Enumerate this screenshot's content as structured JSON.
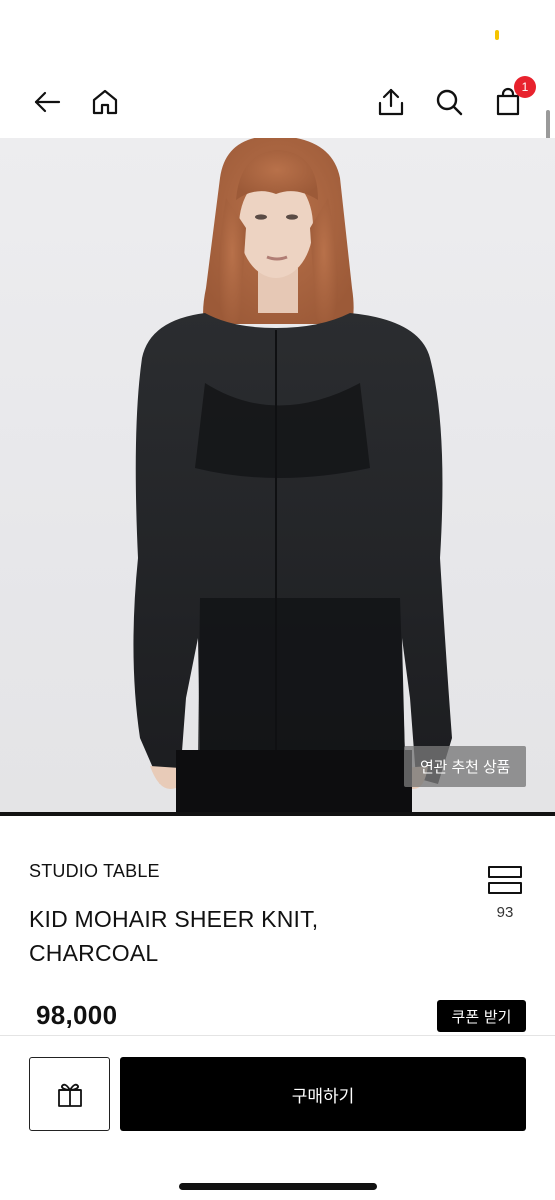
{
  "nav": {
    "back_icon": "arrow-left-icon",
    "home_icon": "home-icon",
    "share_icon": "share-upload-icon",
    "search_icon": "search-icon",
    "cart_icon": "shopping-bag-icon",
    "cart_count": "1"
  },
  "product": {
    "image_subject": "model wearing charcoal sheer knit",
    "related_label": "연관 추천 상품",
    "brand": "STUDIO TABLE",
    "name_line1": "KID MOHAIR SHEER KNIT,",
    "name_line2": "CHARCOAL",
    "layout_count": "93",
    "price": "98,000",
    "coupon_label": "쿠폰 받기"
  },
  "bottom": {
    "gift_icon": "gift-icon",
    "buy_label": "구매하기"
  },
  "colors": {
    "accent": "#000000",
    "badge": "#e8222d",
    "image_bg": "#ececee"
  }
}
